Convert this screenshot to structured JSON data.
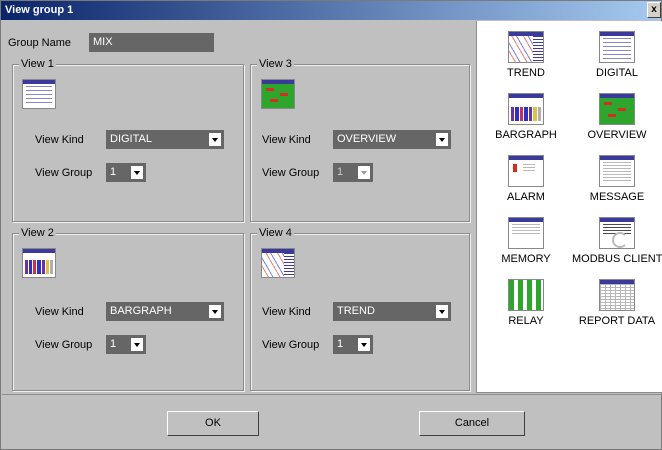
{
  "window": {
    "title": "View group 1",
    "close_glyph": "x"
  },
  "group_name": {
    "label": "Group Name",
    "value": "MIX"
  },
  "views": [
    {
      "legend": "View 1",
      "thumb": "digital",
      "kind_label": "View Kind",
      "kind": "DIGITAL",
      "group_label": "View Group",
      "group": "1",
      "group_enabled": true
    },
    {
      "legend": "View 2",
      "thumb": "bargraph",
      "kind_label": "View Kind",
      "kind": "BARGRAPH",
      "group_label": "View Group",
      "group": "1",
      "group_enabled": true
    },
    {
      "legend": "View 3",
      "thumb": "overview",
      "kind_label": "View Kind",
      "kind": "OVERVIEW",
      "group_label": "View Group",
      "group": "1",
      "group_enabled": false
    },
    {
      "legend": "View 4",
      "thumb": "trend",
      "kind_label": "View Kind",
      "kind": "TREND",
      "group_label": "View Group",
      "group": "1",
      "group_enabled": true
    }
  ],
  "palette": [
    {
      "label": "TREND",
      "icon": "trend-icon"
    },
    {
      "label": "DIGITAL",
      "icon": "digital-icon"
    },
    {
      "label": "BARGRAPH",
      "icon": "bargraph-icon"
    },
    {
      "label": "OVERVIEW",
      "icon": "overview-icon"
    },
    {
      "label": "ALARM",
      "icon": "alarm-icon"
    },
    {
      "label": "MESSAGE",
      "icon": "message-icon"
    },
    {
      "label": "MEMORY",
      "icon": "memory-icon"
    },
    {
      "label": "MODBUS CLIENT",
      "icon": "modbus-client-icon"
    },
    {
      "label": "RELAY",
      "icon": "relay-icon"
    },
    {
      "label": "REPORT DATA",
      "icon": "report-data-icon"
    }
  ],
  "buttons": {
    "ok": "OK",
    "cancel": "Cancel"
  },
  "colors": {
    "title_bar": "#0a246a",
    "dialog_bg": "#c0c0c0",
    "combo_bg": "#666666",
    "overview_green": "#2ea62e"
  }
}
